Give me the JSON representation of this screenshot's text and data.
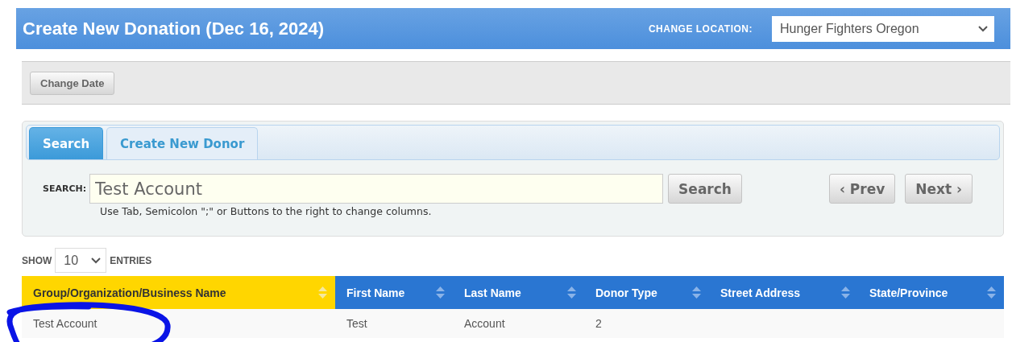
{
  "header": {
    "title": "Create New Donation (Dec 16, 2024)",
    "location_label": "CHANGE LOCATION:",
    "location_value": "Hunger Fighters Oregon"
  },
  "toolbar": {
    "buttons": [
      "Change Date"
    ]
  },
  "tabs": [
    {
      "label": "Search",
      "selected": true
    },
    {
      "label": "Create New Donor",
      "selected": false
    }
  ],
  "search": {
    "label": "SEARCH:",
    "value": "Test Account",
    "button": "Search",
    "hint": "Use Tab, Semicolon \";\" or Buttons to the right to change columns.",
    "prev": "‹ Prev",
    "next": "Next ›"
  },
  "entries": {
    "show": "SHOW",
    "value": "10",
    "suffix": "ENTRIES"
  },
  "table": {
    "columns": [
      {
        "label": "Group/Organization/Business Name",
        "sorted": true
      },
      {
        "label": "First Name",
        "sorted": false
      },
      {
        "label": "Last Name",
        "sorted": false
      },
      {
        "label": "Donor Type",
        "sorted": false
      },
      {
        "label": "Street Address",
        "sorted": false
      },
      {
        "label": "State/Province",
        "sorted": false
      }
    ],
    "rows": [
      [
        "Test Account",
        "Test",
        "Account",
        "2",
        "",
        ""
      ]
    ]
  },
  "annotation": {
    "kind": "ellipse",
    "color": "#0a14e6"
  }
}
